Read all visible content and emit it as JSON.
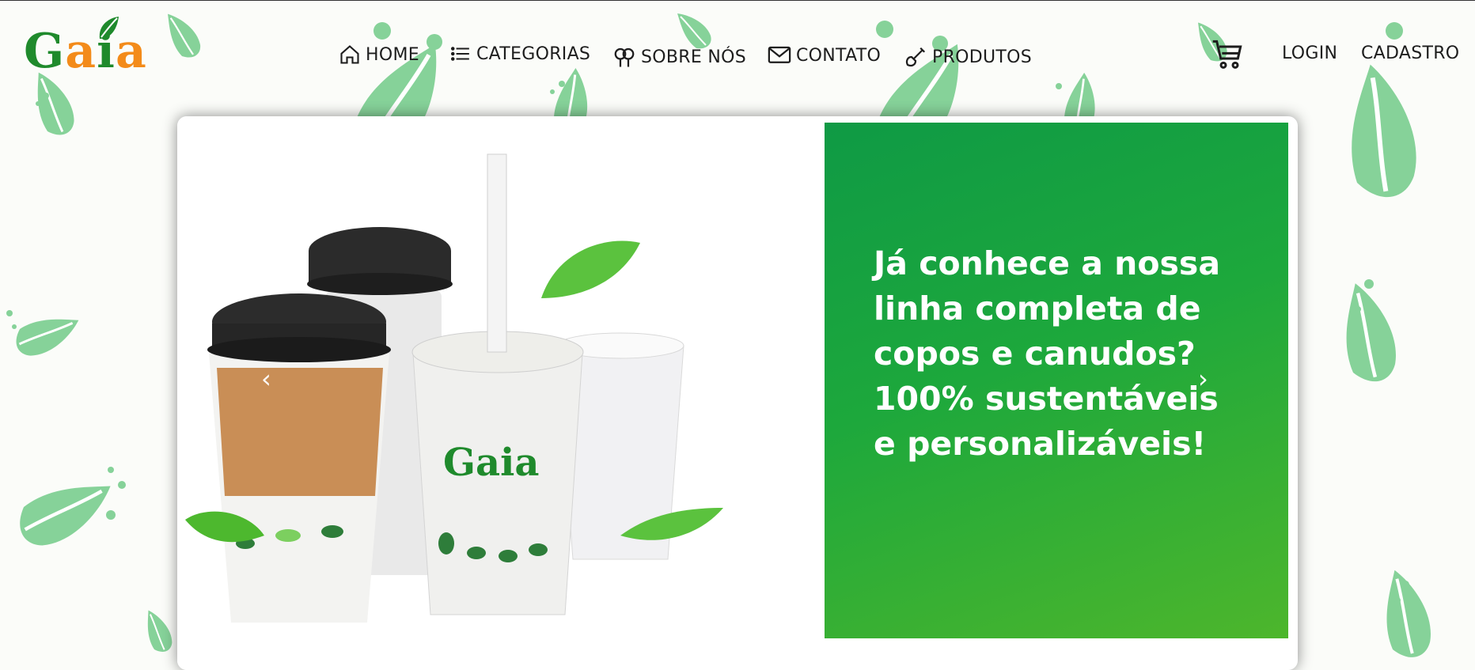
{
  "brand": {
    "logo_letters": [
      "G",
      "a",
      "i",
      "a"
    ],
    "logo_colors": [
      "#1f8a2c",
      "#f38b1a",
      "#1f8a2c",
      "#f38b1a"
    ]
  },
  "nav": {
    "items": [
      {
        "label": "HOME",
        "icon": "home-icon"
      },
      {
        "label": "CATEGORIAS",
        "icon": "list-icon"
      },
      {
        "label": "SOBRE NÓS",
        "icon": "tree-icon"
      },
      {
        "label": "CONTATO",
        "icon": "mail-icon"
      },
      {
        "label": "PRODUTOS",
        "icon": "shovel-icon"
      }
    ],
    "account": {
      "cart_icon": "cart-icon",
      "login_label": "LOGIN",
      "signup_label": "CADASTRO"
    }
  },
  "hero": {
    "promo_lines": [
      "Já conhece a nossa",
      "linha completa de",
      "copos e canudos?",
      "100% sustentáveis",
      "e personalizáveis!"
    ],
    "product_logo": "Gaia",
    "prev_arrow": "‹",
    "next_arrow": "›"
  },
  "colors": {
    "brand_green": "#1f8a2c",
    "brand_orange": "#f38b1a",
    "promo_green": "#1da83c",
    "leaf_green": "#7ccf8f"
  }
}
